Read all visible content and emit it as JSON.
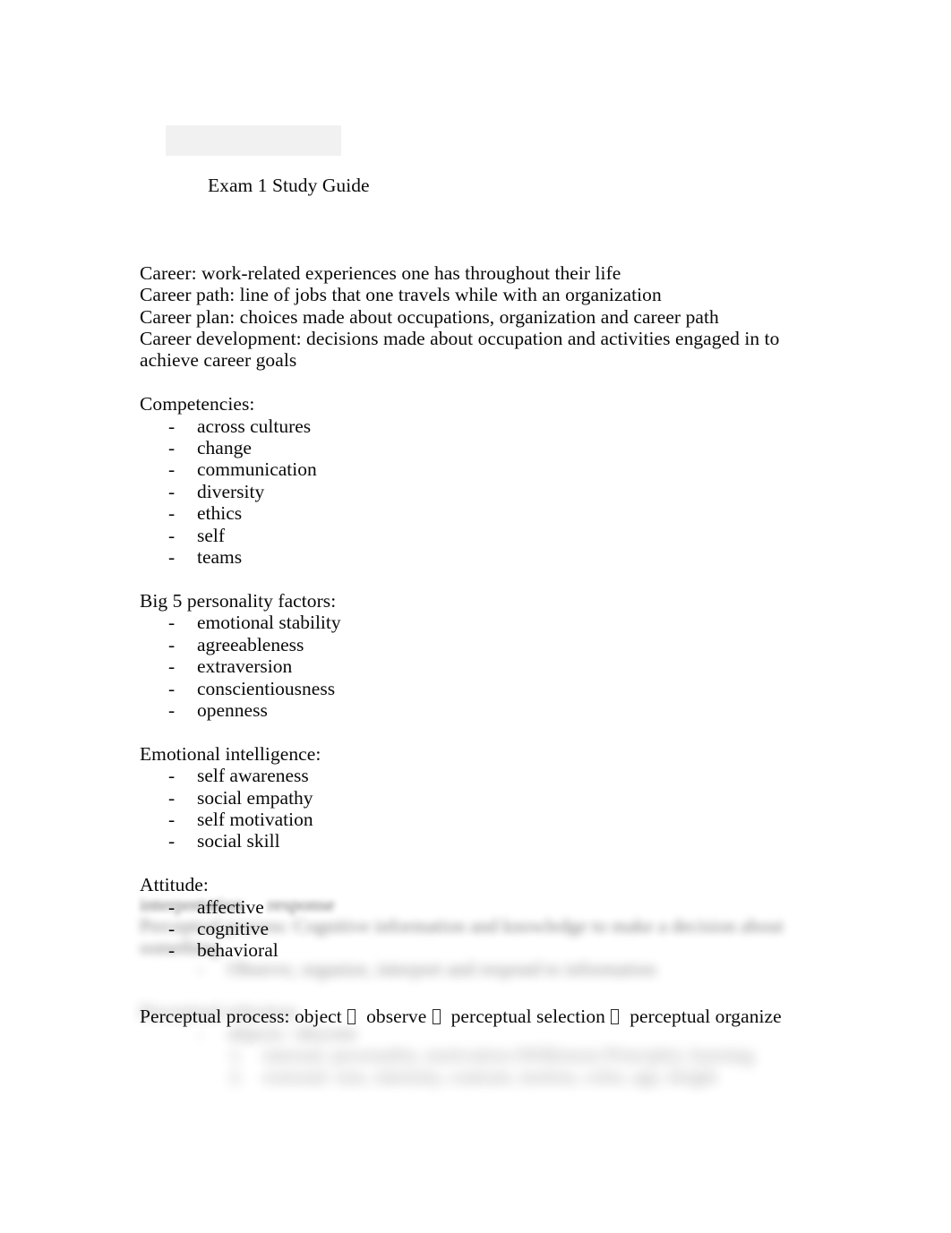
{
  "document": {
    "title": "Exam 1 Study Guide",
    "definitions": [
      "Career: work-related experiences one has throughout their life",
      "Career path: line of jobs that one travels while with an organization",
      "Career plan: choices made about occupations, organization and career path",
      "Career development: decisions made about occupation and activities engaged in to achieve career goals"
    ],
    "sections": [
      {
        "heading": "Competencies:",
        "marker": "-",
        "items": [
          "across cultures",
          "change",
          "communication",
          "diversity",
          "ethics",
          "self",
          "teams"
        ]
      },
      {
        "heading": "Big 5 personality factors:",
        "marker": "-",
        "items": [
          "emotional stability",
          "agreeableness",
          "extraversion",
          "conscientiousness",
          "openness"
        ]
      },
      {
        "heading": "Emotional intelligence:",
        "marker": "-",
        "items": [
          "self awareness",
          "social empathy",
          "self motivation",
          "social skill"
        ]
      },
      {
        "heading": "Attitude:",
        "marker": "-",
        "items": [
          "affective",
          "cognitive",
          "behavioral"
        ]
      }
    ],
    "perceptual_process": {
      "label": "Perceptual process:",
      "steps": [
        "object",
        "observe",
        "perceptual selection",
        "perceptual organize"
      ],
      "arrow_glyph": "missing-glyph-box"
    },
    "blurred_preview": {
      "note": "lower portion of page is blurred preview",
      "lines": [
        {
          "text": "interpretation     response",
          "indent": 0,
          "blur": 1
        },
        {
          "text": "Perceptual process: Cognitive information and knowledge to make a decision about",
          "indent": 0,
          "blur": 2
        },
        {
          "text": "something",
          "indent": 0,
          "blur": 2
        },
        {
          "text": "-     Observe, organize, interpret and respond to information",
          "indent": 1,
          "blur": 3
        },
        {
          "text": "Perceptual selection:",
          "indent": 0,
          "blur": 4
        },
        {
          "text": "-     objects / discrete",
          "indent": 1,
          "blur": 4
        },
        {
          "text": "1.    internal: personality, motivation (Wilkinson Principle), learning",
          "indent": 2,
          "blur": 5
        },
        {
          "text": "2.    external: size, intensity, contrast, motion, color, age, height",
          "indent": 2,
          "blur": 5
        }
      ]
    }
  }
}
